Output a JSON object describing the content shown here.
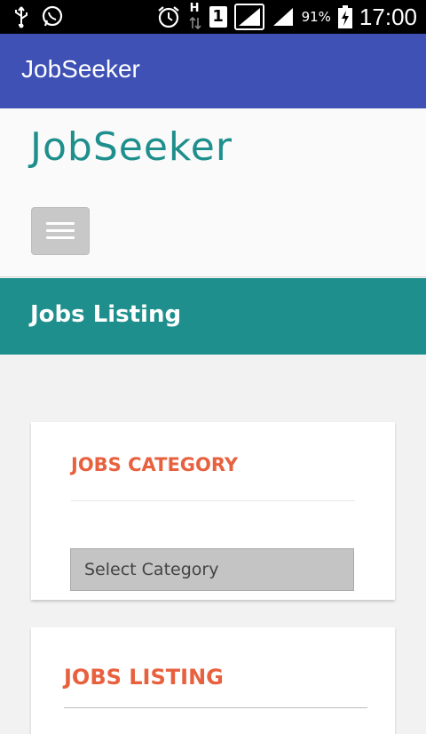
{
  "status_bar": {
    "battery_percent": "91%",
    "time": "17:00",
    "sim_slot": "1",
    "network_type": "H",
    "icons": [
      "usb-icon",
      "whatsapp-icon",
      "alarm-icon",
      "data-transfer-icon",
      "signal-icon",
      "battery-charging-icon"
    ]
  },
  "app_bar": {
    "title": "JobSeeker"
  },
  "site_header": {
    "logo_text": "JobSeeker",
    "menu_icon": "hamburger-icon"
  },
  "page_banner": {
    "title": "Jobs Listing"
  },
  "jobs_category_card": {
    "title": "JOBS CATEGORY",
    "select_placeholder": "Select Category"
  },
  "jobs_listing_card": {
    "title": "JOBS LISTING"
  },
  "colors": {
    "app_bar": "#3f51b5",
    "brand_teal": "#1e8f8c",
    "accent_orange": "#e8613f"
  }
}
